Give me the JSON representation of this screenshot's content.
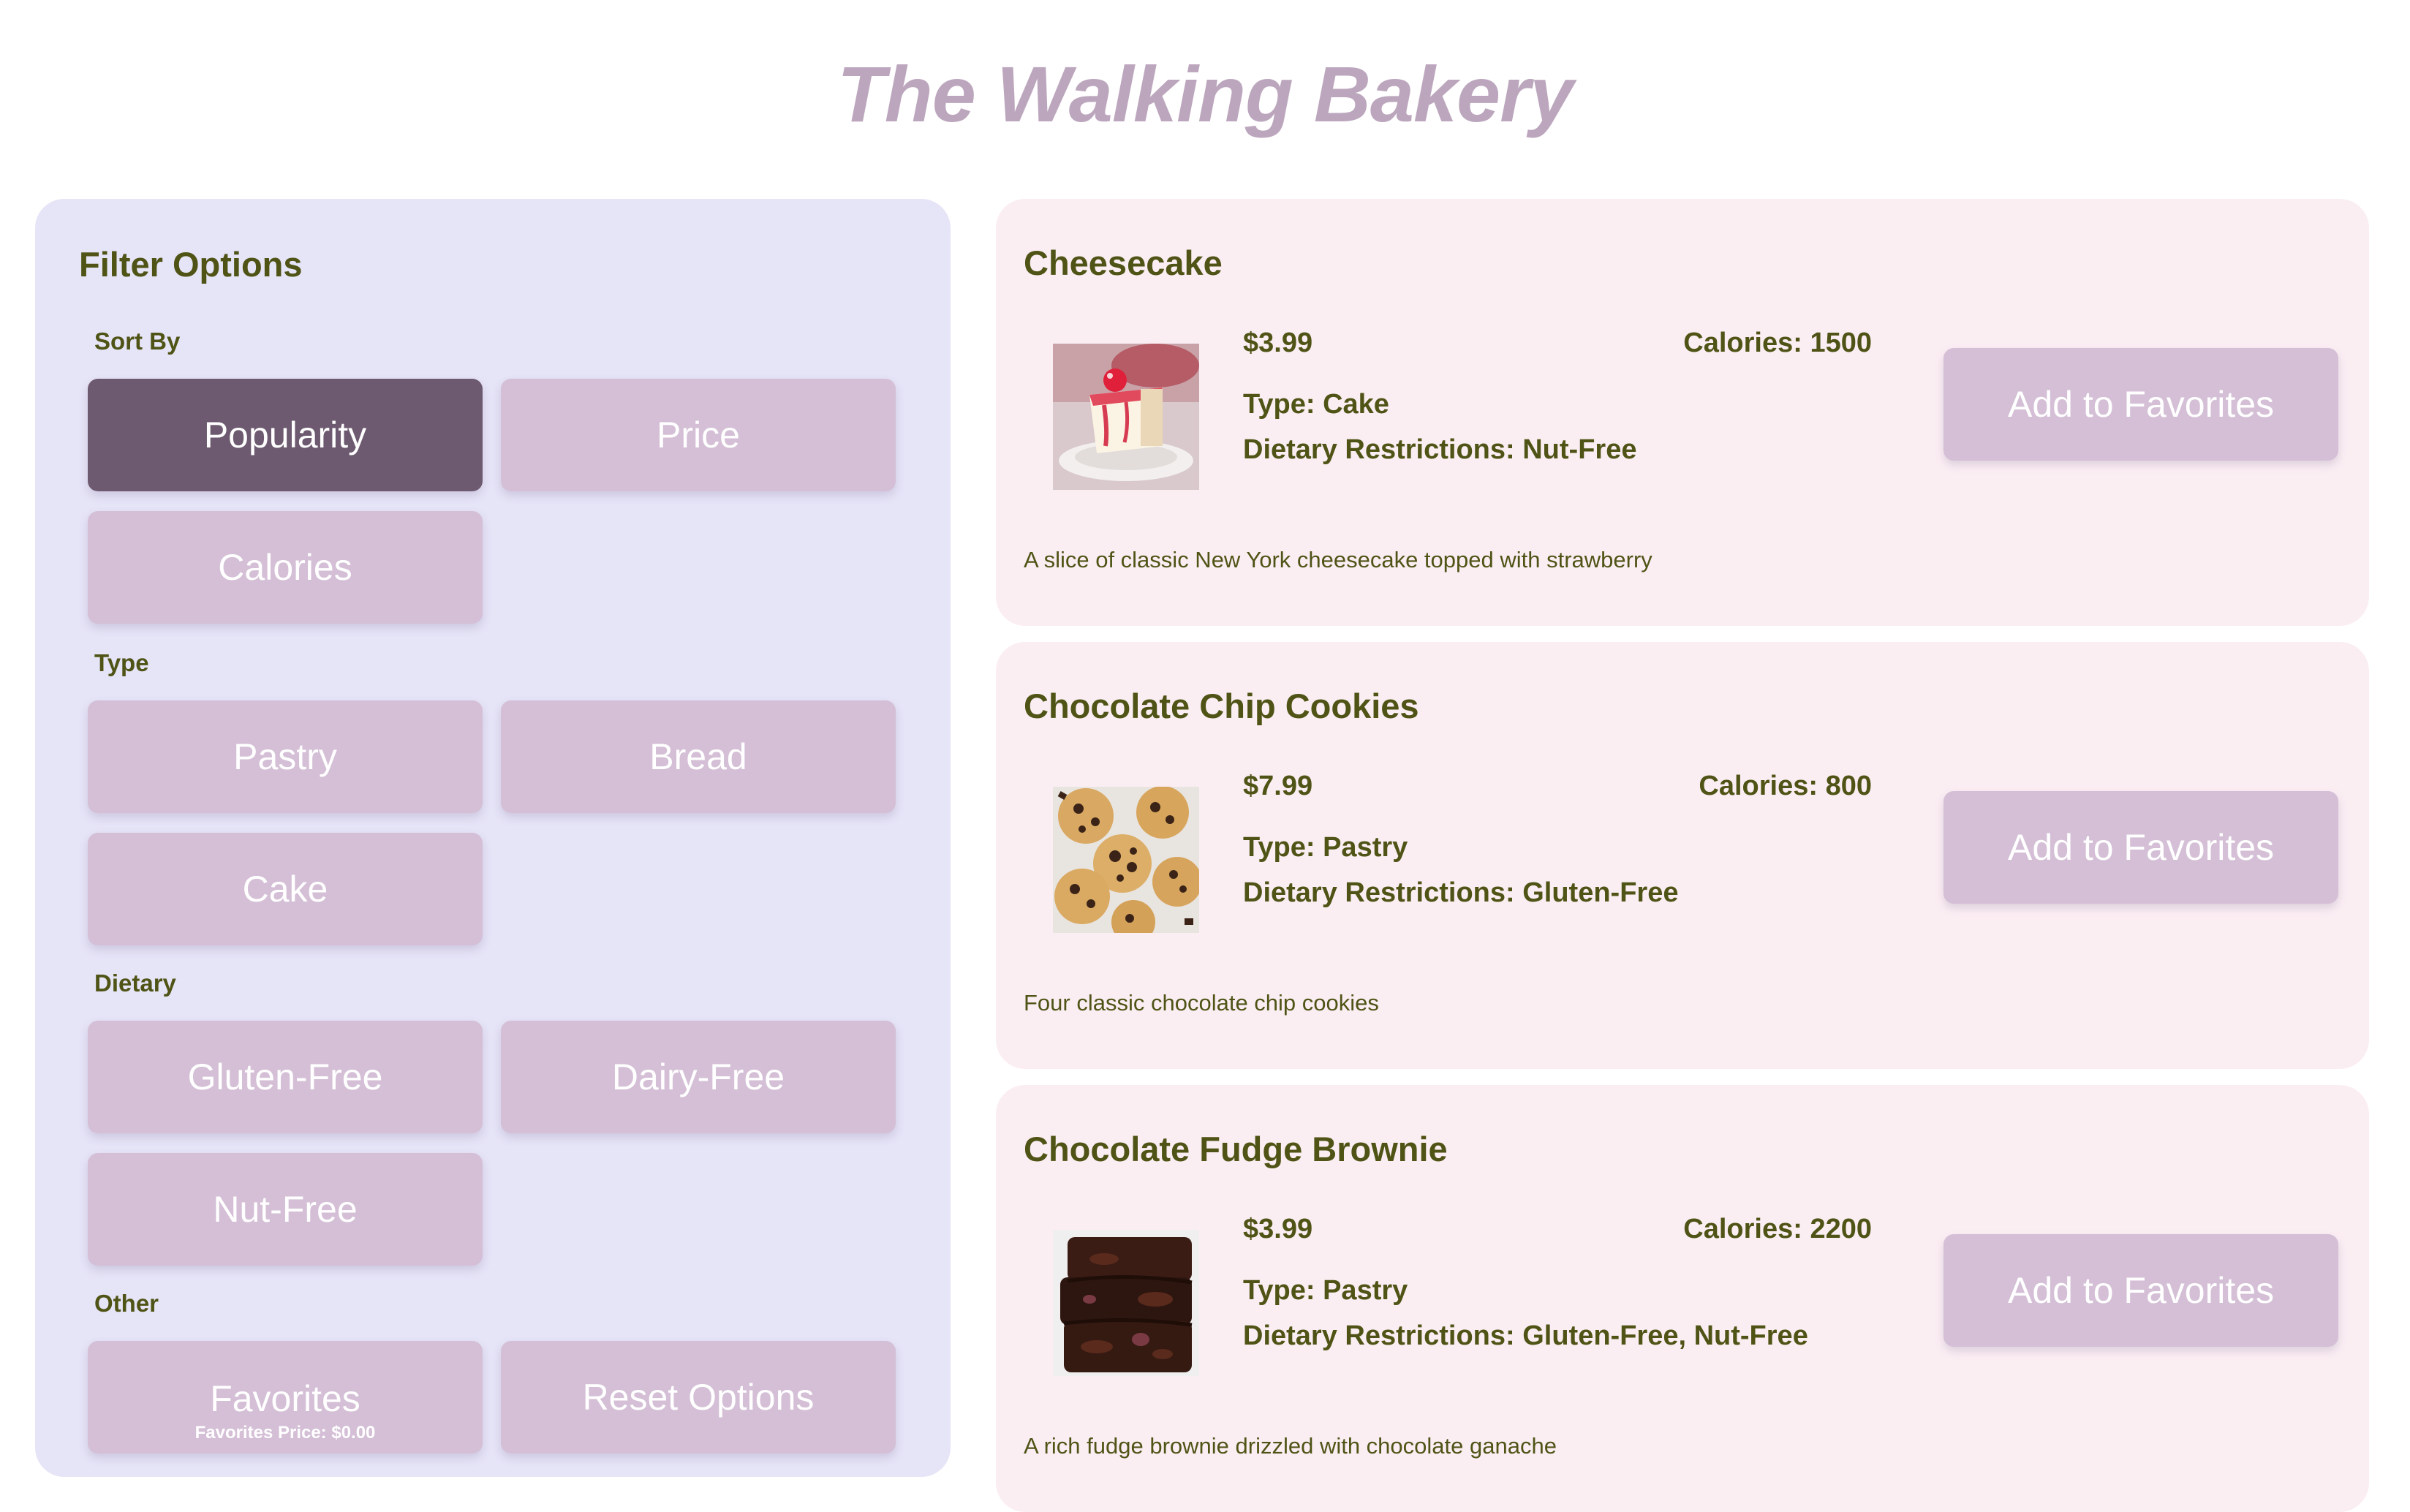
{
  "header": {
    "title": "The Walking Bakery"
  },
  "sidebar": {
    "title": "Filter Options",
    "sort_label": "Sort By",
    "sort_options": [
      "Popularity",
      "Price",
      "Calories"
    ],
    "sort_selected": "Popularity",
    "type_label": "Type",
    "type_options": [
      "Pastry",
      "Bread",
      "Cake"
    ],
    "dietary_label": "Dietary",
    "dietary_options": [
      "Gluten-Free",
      "Dairy-Free",
      "Nut-Free"
    ],
    "other_label": "Other",
    "favorites_label": "Favorites",
    "favorites_price": "Favorites Price: $0.00",
    "reset_label": "Reset Options"
  },
  "products": [
    {
      "name": "Cheesecake",
      "price": "$3.99",
      "calories": "Calories: 1500",
      "type": "Type: Cake",
      "dietary": "Dietary Restrictions: Nut-Free",
      "description": "A slice of classic New York cheesecake topped with strawberry",
      "button_label": "Add to Favorites"
    },
    {
      "name": "Chocolate Chip Cookies",
      "price": "$7.99",
      "calories": "Calories: 800",
      "type": "Type: Pastry",
      "dietary": "Dietary Restrictions: Gluten-Free",
      "description": "Four classic chocolate chip cookies",
      "button_label": "Add to Favorites"
    },
    {
      "name": "Chocolate Fudge Brownie",
      "price": "$3.99",
      "calories": "Calories: 2200",
      "type": "Type: Pastry",
      "dietary": "Dietary Restrictions: Gluten-Free, Nut-Free",
      "description": "A rich fudge brownie drizzled with chocolate ganache",
      "button_label": "Add to Favorites"
    }
  ],
  "colors": {
    "title": "#bca6bd",
    "sidebar_bg": "#e6e4f7",
    "card_bg": "#fbeef3",
    "button_bg": "#d4bfd6",
    "button_active_bg": "#6e5a70",
    "text_olive": "#4f5416"
  }
}
